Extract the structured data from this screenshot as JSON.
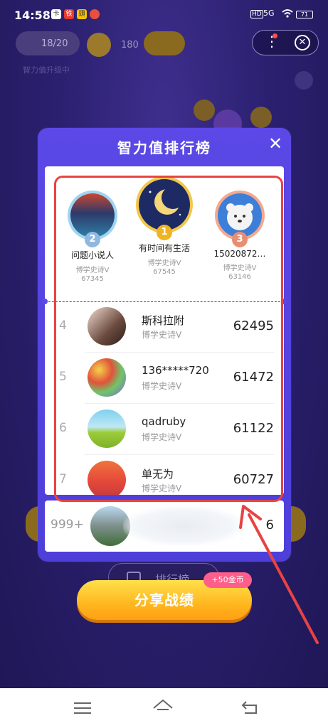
{
  "status_bar": {
    "time": "14:58",
    "notifications": [
      "卡",
      "铁",
      "头条",
      "●"
    ],
    "hd": "HD",
    "signal": "5G",
    "battery": "71"
  },
  "background": {
    "progress_text": "18/20",
    "coins": "180",
    "sub_text": "智力值升级中",
    "tab_label": "排行榜"
  },
  "modal": {
    "title": "智力值排行榜",
    "podium": [
      {
        "rank": "2",
        "name": "问题小说人",
        "title": "博学史诗V",
        "score": "67345"
      },
      {
        "rank": "1",
        "name": "有时间有生活",
        "title": "博学史诗V",
        "score": "67545"
      },
      {
        "rank": "3",
        "name": "15020872…",
        "title": "博学史诗V",
        "score": "63146"
      }
    ],
    "rows": [
      {
        "rank": "4",
        "name": "斯科拉附",
        "title": "博学史诗V",
        "score": "62495"
      },
      {
        "rank": "5",
        "name": "136*****720",
        "title": "博学史诗V",
        "score": "61472"
      },
      {
        "rank": "6",
        "name": "qadruby",
        "title": "博学史诗V",
        "score": "61122"
      },
      {
        "rank": "7",
        "name": "单无为",
        "title": "博学史诗V",
        "score": "60727"
      }
    ],
    "my_rank": {
      "rank": "999+",
      "score": "6"
    }
  },
  "share": {
    "button_label": "分享战绩",
    "bonus_label": "+50金币"
  },
  "colors": {
    "modal_bg": "#5b48e6",
    "accent_gold": "#ffb71f",
    "highlight_red": "#e84343"
  }
}
